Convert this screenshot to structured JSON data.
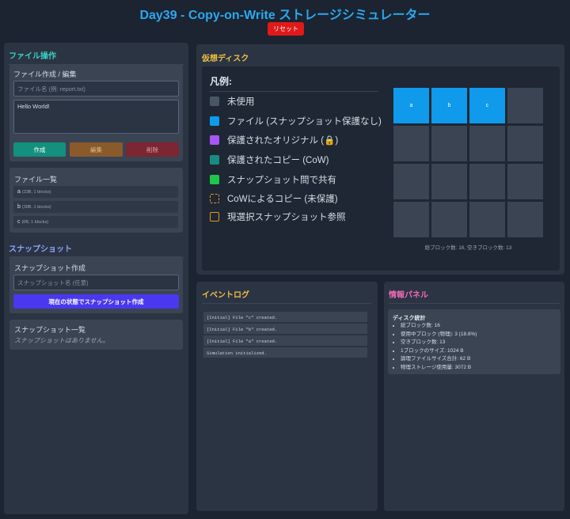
{
  "header": {
    "title": "Day39 - Copy-on-Write ストレージシミュレーター",
    "reset_label": "リセット"
  },
  "colors": {
    "accent_blue": "#2ba8f0",
    "file_block": "#0f9aec",
    "protected_original": "#a855f7",
    "protected_copy": "#1a8b82",
    "shared": "#1fc64b",
    "cow_copy_border": "#e0962a",
    "current_ref_border": "#e0962a",
    "unused": "#4a5565"
  },
  "file_ops": {
    "title": "ファイル操作",
    "editor_title": "ファイル作成 / 編集",
    "filename_placeholder": "ファイル名 (例: report.txt)",
    "content_value": "Hello World!",
    "create_label": "作成",
    "edit_label": "編集",
    "delete_label": "削除",
    "list_title": "ファイル一覧",
    "files": [
      {
        "name": "a",
        "meta": "(23B, 1 blocks)"
      },
      {
        "name": "b",
        "meta": "(39B, 1 blocks)"
      },
      {
        "name": "c",
        "meta": "(0B, 1 blocks)"
      }
    ]
  },
  "snapshots": {
    "title": "スナップショット",
    "create_title": "スナップショット作成",
    "name_placeholder": "スナップショット名 (任意)",
    "create_button": "現在の状態でスナップショット作成",
    "list_title": "スナップショット一覧",
    "empty_text": "スナップショットはありません。"
  },
  "disk": {
    "title": "仮想ディスク",
    "legend_title": "凡例:",
    "legend": [
      "未使用",
      "ファイル (スナップショット保護なし)",
      "保護されたオリジナル (🔒)",
      "保護されたコピー (CoW)",
      "スナップショット間で共有",
      "CoWによるコピー (未保護)",
      "現選択スナップショット参照"
    ],
    "blocks": [
      "a",
      "b",
      "c",
      "",
      "",
      "",
      "",
      "",
      "",
      "",
      "",
      "",
      "",
      "",
      "",
      ""
    ],
    "summary": "総ブロック数: 16, 空きブロック数: 13"
  },
  "event_log": {
    "title": "イベントログ",
    "entries": [
      "[Initial] File \"c\" created.",
      "[Initial] File \"b\" created.",
      "[Initial] File \"a\" created.",
      "Simulation initialized."
    ]
  },
  "info": {
    "title": "情報パネル",
    "stats_title": "ディスク統計",
    "stats": [
      "総ブロック数: 16",
      "使用中ブロック (物理): 3 (18.8%)",
      "空きブロック数: 13",
      "1ブロックのサイズ: 1024 B",
      "論理ファイルサイズ合計: 62 B",
      "物理ストレージ使用量: 3072 B"
    ]
  }
}
